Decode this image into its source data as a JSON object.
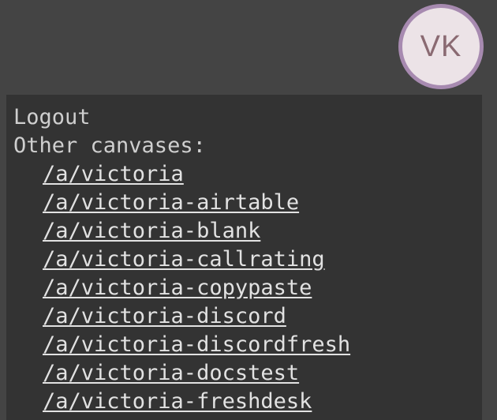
{
  "user": {
    "initials": "VK"
  },
  "menu": {
    "logout_label": "Logout",
    "other_canvases_label": "Other canvases:",
    "canvases": [
      "/a/victoria",
      "/a/victoria-airtable",
      "/a/victoria-blank",
      "/a/victoria-callrating",
      "/a/victoria-copypaste",
      "/a/victoria-discord",
      "/a/victoria-discordfresh",
      "/a/victoria-docstest",
      "/a/victoria-freshdesk"
    ]
  },
  "colors": {
    "page_background": "#444444",
    "panel_background": "#333333",
    "avatar_fill": "#ece3e7",
    "avatar_ring": "#a78ab0",
    "avatar_text": "#8a6a72",
    "text": "#cfcfcf"
  }
}
